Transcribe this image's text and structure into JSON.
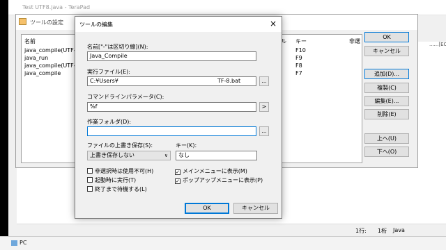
{
  "editor": {
    "title": "Test UTF8.java - TeraPad",
    "edge_text": "...",
    "right_strip": "......[EO",
    "status": {
      "line": "1行:",
      "col": "1桁",
      "lang": "Java"
    }
  },
  "taskbar": {
    "label": "PC"
  },
  "tools_window": {
    "title": "ツールの設定",
    "columns": {
      "name": "名前",
      "prefix": "ル",
      "key": "キー",
      "hidden": "非選"
    },
    "rows": [
      {
        "name": "java_compile(UTF-8",
        "key": "F10"
      },
      {
        "name": "java_run",
        "key": "F9"
      },
      {
        "name": "java_compile(UTF-8",
        "key": "F8"
      },
      {
        "name": "java_compile",
        "key": "F7"
      }
    ],
    "buttons": {
      "ok": "OK",
      "cancel": "キャンセル",
      "add": "追加(D)...",
      "copy": "複製(C)",
      "edit": "編集(E)...",
      "delete": "削除(E)",
      "up": "上へ(U)",
      "down": "下へ(O)"
    }
  },
  "dialog": {
    "title": "ツールの編集",
    "close": "×",
    "name_label": "名前[\"-\"は区切り線](N):",
    "name_value": "Java_Compile",
    "exe_label": "実行ファイル(E):",
    "exe_value": "C:¥Users¥",
    "exe_value_tail": "TF-8.bat",
    "cmd_label": "コマンドラインパラメータ(C):",
    "cmd_value": "%f",
    "workdir_label": "作業フォルダ(D):",
    "workdir_value": "",
    "overwrite_label": "ファイルの上書き保存(S):",
    "overwrite_value": "上書き保存しない",
    "key_label": "キー(K):",
    "key_value": "なし",
    "checkboxes": {
      "disable_unselected": {
        "label": "非選択時は使用不可(H)",
        "checked": false
      },
      "run_on_start": {
        "label": "起動時に実行(T)",
        "checked": false
      },
      "wait_finish": {
        "label": "終了まで待機する(L)",
        "checked": false
      },
      "main_menu": {
        "label": "メインメニューに表示(M)",
        "checked": true
      },
      "popup_menu": {
        "label": "ポップアップメニューに表示(P)",
        "checked": true
      }
    },
    "ok": "OK",
    "cancel": "キャンセル"
  },
  "colors": {
    "focus": "#0078d7",
    "dialog_bg": "#f0f0f0"
  }
}
